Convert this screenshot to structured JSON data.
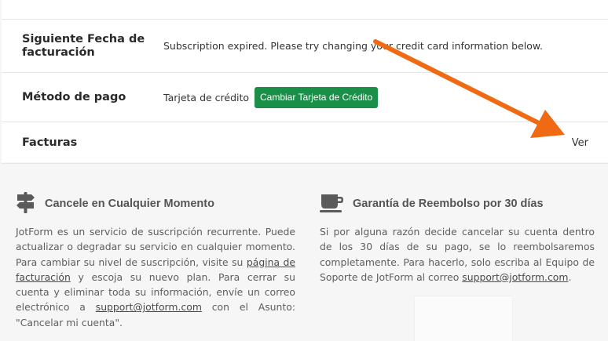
{
  "billing": {
    "next_date": {
      "label": "Siguiente Fecha de facturación",
      "value": "Subscription expired. Please try changing your credit card information below."
    },
    "payment_method": {
      "label": "Método de pago",
      "value": "Tarjeta de crédito",
      "button": "Cambiar Tarjeta de Crédito"
    },
    "invoices": {
      "label": "Facturas",
      "link": "Ver"
    }
  },
  "features": {
    "cancel": {
      "title": "Cancele en Cualquier Momento",
      "icon": "signpost-icon",
      "p1": "JotForm es un servicio de suscripción recurrente. Puede actualizar o degradar su servicio en cualquier momento. Para cambiar su nivel de suscripción, visite su ",
      "link1": "página de facturación",
      "p2": " y escoja su nuevo plan. Para cerrar su cuenta y eliminar toda su información, envíe un correo electrónico a ",
      "link2": "support@jotform.com",
      "p3": " con el Asunto: \"Cancelar mi cuenta\"."
    },
    "refund": {
      "title": "Garantía de Reembolso por 30 días",
      "icon": "coffee-cup-icon",
      "p1": "Si por alguna razón decide cancelar su cuenta dentro de los 30 días de su pago, se lo reembolsaremos completamente. Para hacerlo, solo escriba al Equipo de Soporte de JotForm al correo ",
      "link1": "support@jotform.com",
      "p2": "."
    }
  },
  "colors": {
    "button_green": "#1a8f47",
    "annotation_arrow": "#f06a14"
  }
}
